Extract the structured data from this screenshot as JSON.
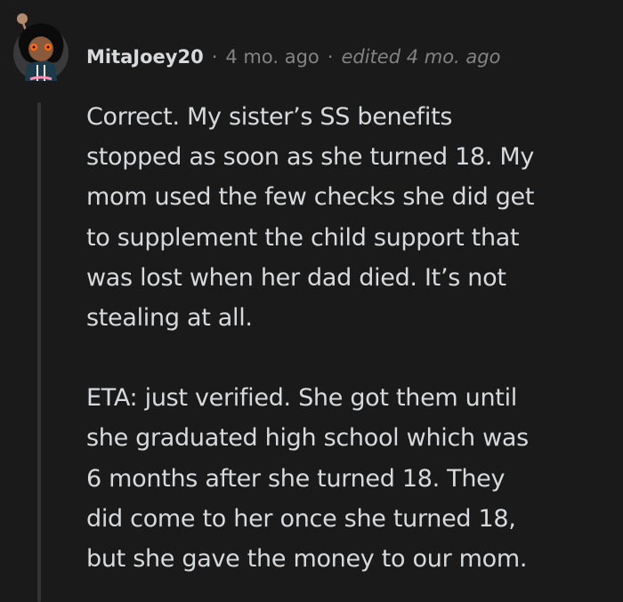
{
  "comment": {
    "username": "MitaJoey20",
    "separator": "·",
    "time": "4 mo. ago",
    "edited": "edited 4 mo. ago",
    "paragraphs": [
      {
        "lines": [
          "Correct. My sister’s SS benefits",
          "stopped as soon as she turned 18. My",
          "mom used the few checks she did get",
          "to supplement the child support that",
          "was lost when her dad died. It’s not",
          "stealing at all."
        ]
      },
      {
        "lines": [
          "ETA: just verified. She got them until",
          "she graduated high school which was",
          "6 months after she turned 18. They",
          "did come to her once she turned 18,",
          "but she gave the money to our mom."
        ]
      }
    ]
  },
  "colors": {
    "background": "#1a1a1b",
    "text": "#d7dadc",
    "meta": "#818384",
    "thread_line": "#343536"
  }
}
